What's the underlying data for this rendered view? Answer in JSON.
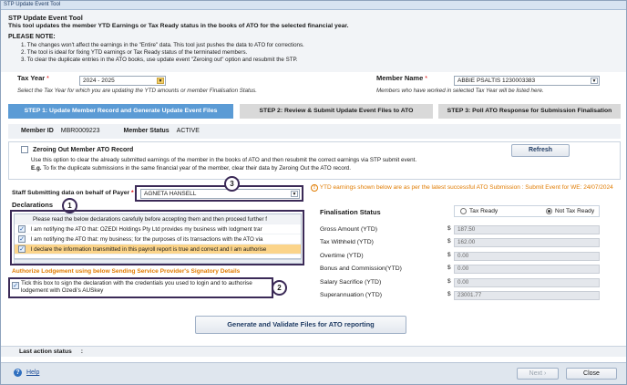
{
  "window": {
    "title": "STP Update Event Tool"
  },
  "header": {
    "title": "STP Update Event Tool",
    "subtitle": "This tool updates the member YTD Earnings or Tax Ready status in the books of ATO for the selected financial year.",
    "note_heading": "PLEASE NOTE:",
    "notes": [
      "1. The changes won't affect the earnings in the \"Entire\" data. This tool just pushes the data to ATO for corrections.",
      "2. The tool is ideal for fixing YTD earnings or Tax Ready status of the terminated members.",
      "3. To clear the duplicate entries in the ATO books, use update event \"Zeroing out\" option and resubmit the STP."
    ]
  },
  "tax_year": {
    "label": "Tax Year",
    "required_mark": "*",
    "value": "2024 - 2025",
    "hint": "Select the Tax Year for which you are updating the YTD amounts or member Finalisation Status."
  },
  "member_name": {
    "label": "Member Name",
    "required_mark": "*",
    "value": "ABBIE PSALTIS 1230003383",
    "hint": "Members who have worked in selected Tax Year will be listed here."
  },
  "steps": [
    {
      "label": "STEP 1: Update Member Record and Generate Update Event Files"
    },
    {
      "label": "STEP 2: Review & Submit Update Event Files to ATO"
    },
    {
      "label": "STEP 3: Poll ATO Response for Submission Finalisation"
    }
  ],
  "member_info": {
    "id_label": "Member ID",
    "id_value": "MBR0009223",
    "status_label": "Member Status",
    "status_value": "ACTIVE"
  },
  "zeroing": {
    "label": "Zeroing Out Member ATO Record",
    "desc": "Use this option to clear the already submitted earnings of the member in the books of ATO and then resubmit the correct earnings via STP submit event.",
    "eg_label": "E.g.",
    "eg_text": "To fix the duplicate submissions in the same financial year of the member, clear their data by Zeroing Out the ATO record.",
    "refresh": "Refresh"
  },
  "payer": {
    "label": "Staff Submitting data on behalf of Payer",
    "required_mark": "*",
    "value": "AGNETA HANSELL"
  },
  "ytd_note": "YTD earnings shown below are as per the latest successful ATO Submission : Submit Event for WE: 24/07/2024",
  "declarations": {
    "title": "Declarations",
    "rows": [
      "Please read the below declarations carefully before accepting them and then proceed further f",
      "I am notifying the ATO that: OZEDI Holdings Pty Ltd provides my business with lodgment trar",
      "I am notifying the ATO that: my business; for the purposes of its transactions with the ATO via",
      "I declare the information transmitted in this payroll report is true and correct and I am authorise"
    ]
  },
  "authorize": {
    "title": "Authorize Lodgement using below Sending Service Provider's Signatory Details",
    "text": "Tick this box to sign the declaration with the credentials you used to login and to authorise lodgement with Ozedi's AUSkey"
  },
  "callouts": [
    "1",
    "2",
    "3"
  ],
  "finalisation": {
    "label": "Finalisation Status",
    "options": [
      "Tax Ready",
      "Not Tax Ready"
    ],
    "selected": "Not Tax Ready"
  },
  "amounts": [
    {
      "label": "Gross Amount (YTD)",
      "value": "187.50"
    },
    {
      "label": "Tax Withheld (YTD)",
      "value": "162.00"
    },
    {
      "label": "Overtime (YTD)",
      "value": "0.00"
    },
    {
      "label": "Bonus and Commission(YTD)",
      "value": "0.00"
    },
    {
      "label": "Salary Sacrifice (YTD)",
      "value": "0.00"
    },
    {
      "label": "Superannuation (YTD)",
      "value": "23001.77"
    }
  ],
  "currency": "$",
  "generate_button": "Generate and Validate Files for ATO reporting",
  "last_action": {
    "label": "Last action status",
    "sep": ":"
  },
  "footer": {
    "help": "Help",
    "next": "Next",
    "close": "Close"
  },
  "colors": {
    "accent": "#5b9bd5",
    "warning": "#e07b00",
    "callout": "#3b2a57"
  }
}
